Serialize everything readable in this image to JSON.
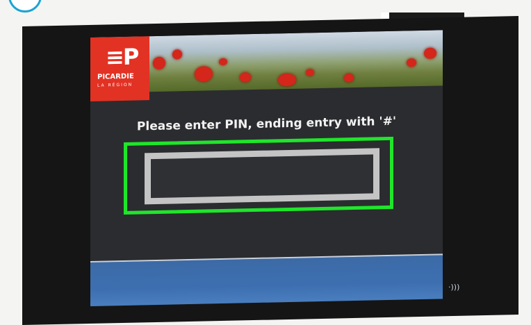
{
  "logo": {
    "name": "PICARDIE",
    "subtitle": "LA RÉGION"
  },
  "prompt": {
    "text": "Please enter PIN, ending entry with '#'"
  },
  "pin_field": {
    "value": ""
  },
  "icons": {
    "contactless": "contactless-icon"
  },
  "colors": {
    "highlight": "#1fe62a",
    "brand_red": "#e23224",
    "footer_blue": "#3d6fb0"
  }
}
